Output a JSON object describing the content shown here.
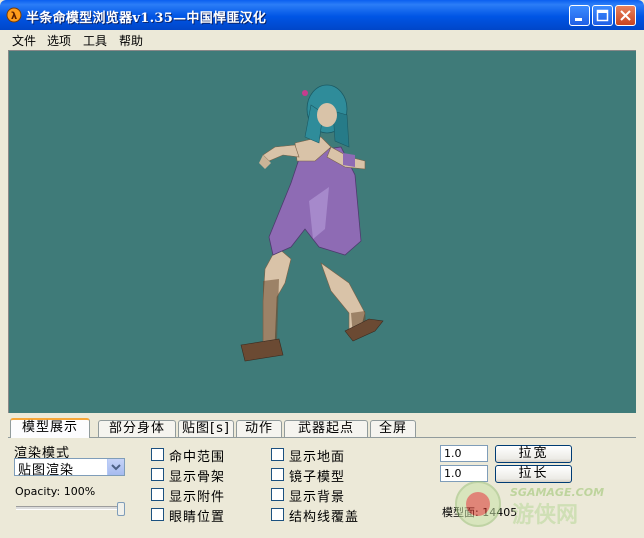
{
  "window": {
    "title": "半条命模型浏览器v1.35—中国悍匪汉化",
    "buttons": [
      "minimize",
      "maximize",
      "close"
    ]
  },
  "menu": [
    "文件",
    "选项",
    "工具",
    "帮助"
  ],
  "tabs": [
    {
      "label": "模型展示",
      "active": true
    },
    {
      "label": "部分身体",
      "active": false
    },
    {
      "label": "贴图[s]",
      "active": false
    },
    {
      "label": "动作",
      "active": false
    },
    {
      "label": "武器起点",
      "active": false
    },
    {
      "label": "全屏",
      "active": false
    }
  ],
  "render": {
    "mode_label": "渲染模式",
    "mode_value": "贴图渲染",
    "opacity_label": "Opacity: 100%",
    "opacity_level": 1.0
  },
  "checkboxes_col1": [
    {
      "label": "命中范围",
      "checked": false
    },
    {
      "label": "显示骨架",
      "checked": false
    },
    {
      "label": "显示附件",
      "checked": false
    },
    {
      "label": "眼睛位置",
      "checked": false
    }
  ],
  "checkboxes_col2": [
    {
      "label": "显示地面",
      "checked": false
    },
    {
      "label": "镜子模型",
      "checked": false
    },
    {
      "label": "显示背景",
      "checked": false
    },
    {
      "label": "结构线覆盖",
      "checked": false
    }
  ],
  "scale": {
    "width_value": "1.0",
    "width_button": "拉宽",
    "height_value": "1.0",
    "height_button": "拉长",
    "faces_label": "模型面: 14405"
  },
  "watermark": {
    "line1": "SGAMAGE.COM",
    "line2": "游侠网"
  },
  "colors": {
    "viewport_bg": "#3f7b79",
    "titlebar": "#0055e5",
    "dress": "#8e6bb4",
    "hair": "#2f8c9a",
    "skin": "#d9c3a8"
  }
}
